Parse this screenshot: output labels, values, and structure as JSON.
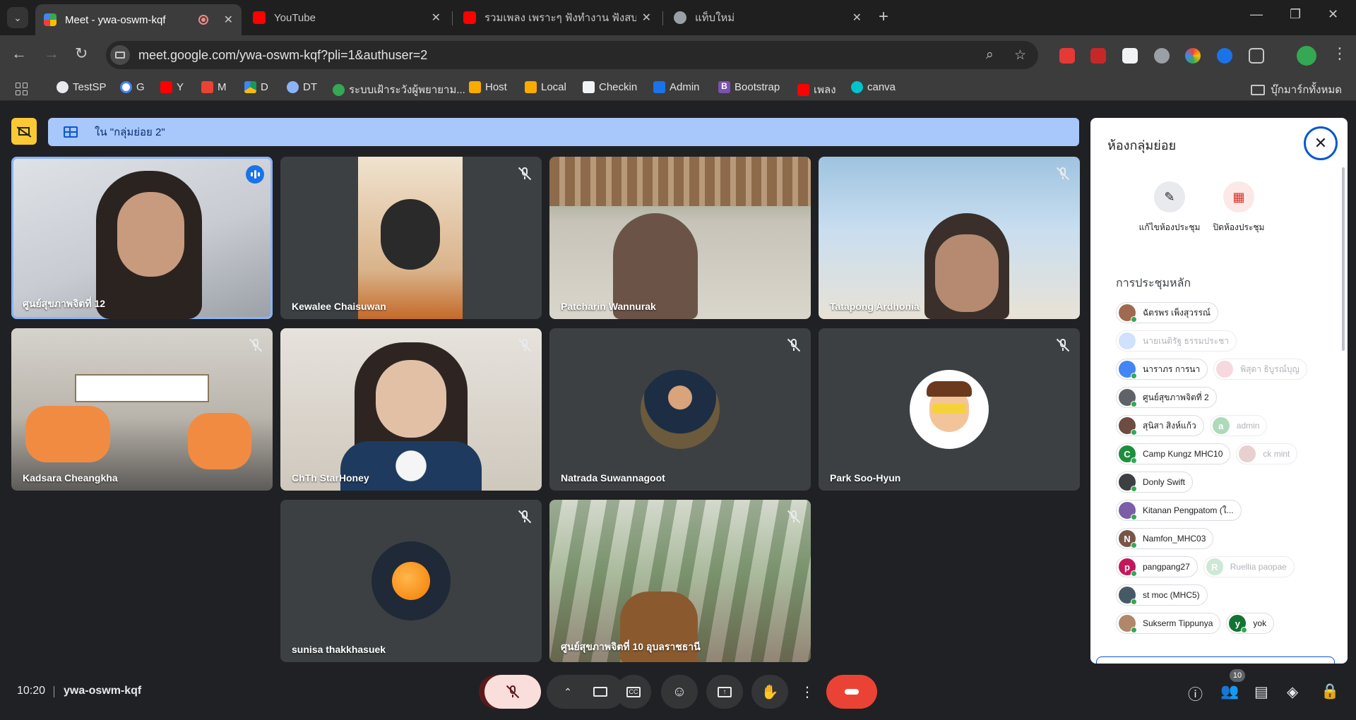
{
  "browser": {
    "tabs": [
      {
        "title": "Meet - ywa-oswm-kqf",
        "active": true
      },
      {
        "title": "YouTube",
        "active": false
      },
      {
        "title": "รวมเพลง เพราะๆ ฟังทำงาน ฟังสบายๆ",
        "active": false
      },
      {
        "title": "แท็บใหม่",
        "active": false
      }
    ],
    "url": "meet.google.com/ywa-oswm-kqf?pli=1&authuser=2",
    "bookmarks": [
      "TestSP",
      "G",
      "Y",
      "M",
      "D",
      "DT",
      "ระบบเฝ้าระวังผู้พยายาม...",
      "Host",
      "Local",
      "Checkin",
      "Admin",
      "Bootstrap",
      "เพลง",
      "canva"
    ],
    "all_bookmarks": "บุ๊กมาร์กทั้งหมด"
  },
  "meet": {
    "banner": "ใน \"กลุ่มย่อย 2\"",
    "participants": [
      {
        "name": "ศูนย์สุขภาพจิตที่ 12",
        "speaking": true,
        "muted": false
      },
      {
        "name": "Kewalee Chaisuwan",
        "muted": true
      },
      {
        "name": "Patcharin Wannurak",
        "muted": false
      },
      {
        "name": "Tatapong Ardhonia",
        "muted": true
      },
      {
        "name": "Kadsara Cheangkha",
        "muted": true
      },
      {
        "name": "ChTh StarHoney",
        "muted": true
      },
      {
        "name": "Natrada Suwannagoot",
        "muted": true
      },
      {
        "name": "Park Soo-Hyun",
        "muted": true
      },
      {
        "name": "sunisa thakkhasuek",
        "muted": true
      },
      {
        "name": "ศูนย์สุขภาพจิตที่ 10 อุบลราชธานี",
        "muted": true
      }
    ],
    "clock": "10:20",
    "meeting_code": "ywa-oswm-kqf",
    "people_count": "10"
  },
  "panel": {
    "title": "ห้องกลุ่มย่อย",
    "edit_label": "แก้ไขห้องประชุม",
    "close_label": "ปิดห้องประชุม",
    "section": "การประชุมหลัก",
    "chips": [
      [
        {
          "name": "ฉัตรพร เพ็งสุวรรณ์",
          "faded": false
        }
      ],
      [
        {
          "name": "นายเนติรัฐ ธรรมประชา",
          "faded": true
        }
      ],
      [
        {
          "name": "นาราภร การนา",
          "faded": false
        },
        {
          "name": "พิสุดา ธิบูรณ์บุญ",
          "faded": true
        }
      ],
      [
        {
          "name": "ศูนย์สุขภาพจิตที่ 2",
          "faded": false
        }
      ],
      [
        {
          "name": "สุนิสา สิงห์แก้ว",
          "faded": false
        },
        {
          "name": "admin",
          "faded": true,
          "initial": "a"
        }
      ],
      [
        {
          "name": "Camp Kungz MHC10",
          "faded": false,
          "initial": "C"
        },
        {
          "name": "ck mint",
          "faded": true
        }
      ],
      [
        {
          "name": "Donly Swift",
          "faded": false
        }
      ],
      [
        {
          "name": "Kitanan Pengpatom (ใ...",
          "faded": false
        }
      ],
      [
        {
          "name": "Namfon_MHC03",
          "faded": false,
          "initial": "N"
        }
      ],
      [
        {
          "name": "pangpang27",
          "faded": false,
          "initial": "p"
        },
        {
          "name": "Ruellia paopae",
          "faded": true,
          "initial": "R"
        }
      ],
      [
        {
          "name": "st moc (MHC5)",
          "faded": false
        }
      ],
      [
        {
          "name": "Sukserm Tippunya",
          "faded": false
        },
        {
          "name": "yok",
          "faded": false,
          "initial": "y"
        }
      ]
    ]
  },
  "colors": {
    "banner_bg": "#a8c7fa",
    "end_call": "#ea4335",
    "speaking_outline": "#8ab4f8",
    "panel_accent": "#0b57d0"
  }
}
